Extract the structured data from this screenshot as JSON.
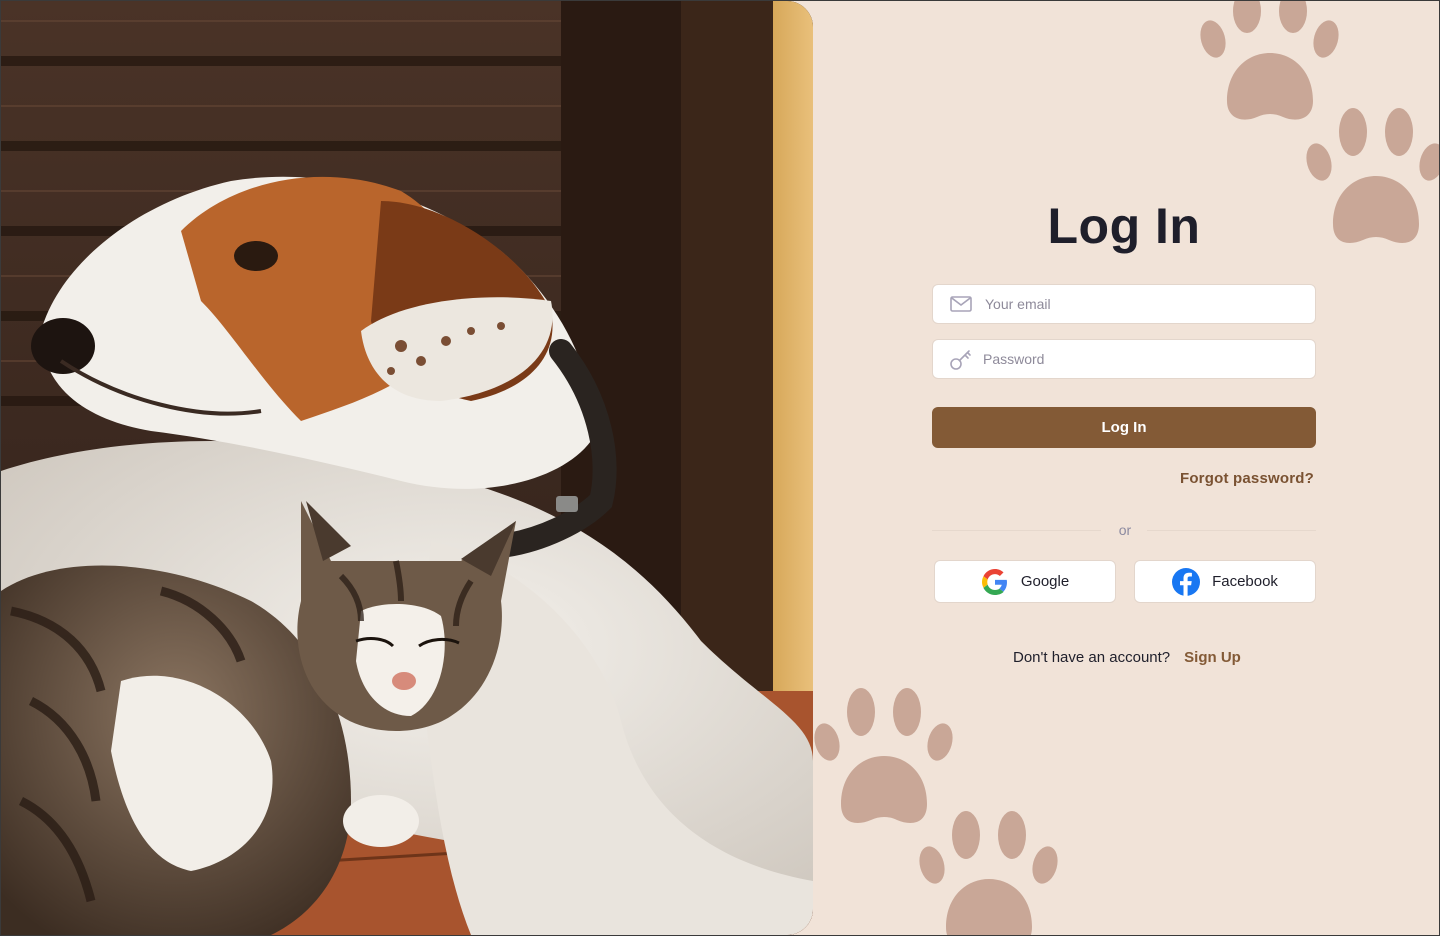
{
  "colors": {
    "page_background": "#f1e3d8",
    "primary_button": "#835a36",
    "link": "#835a36",
    "paw": "#c9a797",
    "title": "#1f1f2b"
  },
  "photo": {
    "subject": "dog-and-cat-photo"
  },
  "form": {
    "title": "Log In",
    "email": {
      "placeholder": "Your email",
      "value": "",
      "icon": "envelope-icon"
    },
    "password": {
      "placeholder": "Password",
      "value": "",
      "icon": "key-icon"
    },
    "login_button": "Log In",
    "forgot_password": "Forgot password?",
    "divider_text": "or",
    "social": [
      {
        "label": "Google",
        "icon": "google-icon"
      },
      {
        "label": "Facebook",
        "icon": "facebook-icon"
      }
    ],
    "signup_prompt": "Don't have an account?",
    "signup_link": "Sign Up"
  },
  "decorations": {
    "icon": "paw-print-icon",
    "count": 4
  }
}
